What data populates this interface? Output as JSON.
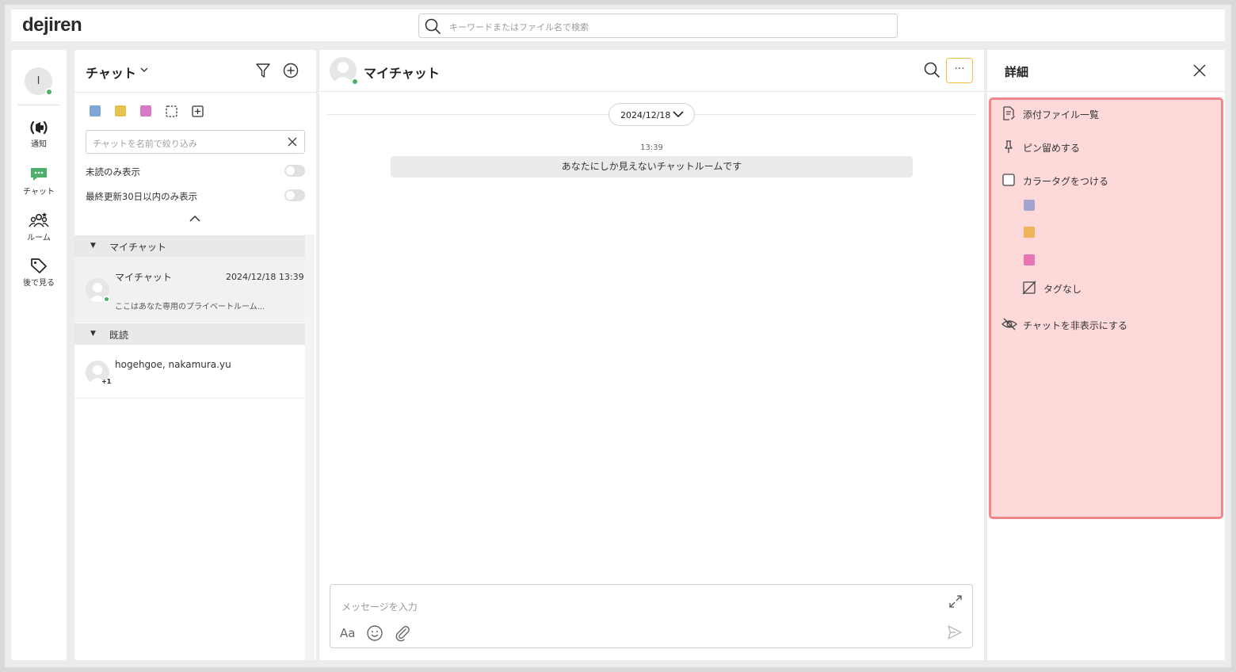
{
  "app": {
    "logo": "dejiren"
  },
  "search": {
    "placeholder": "キーワードまたはファイル名で検索"
  },
  "rail": {
    "avatar_initial": "I",
    "items": [
      {
        "label": "通知",
        "icon": "broadcast-icon"
      },
      {
        "label": "チャット",
        "icon": "chat-icon"
      },
      {
        "label": "ルーム",
        "icon": "people-icon"
      },
      {
        "label": "後で見る",
        "icon": "tag-icon"
      }
    ]
  },
  "chatlist": {
    "title": "チャット",
    "color_tags": [
      "#7ea7d8",
      "#e6c24f",
      "#d97ac8"
    ],
    "filter_placeholder": "チャットを名前で絞り込み",
    "toggles": [
      {
        "label": "未読のみ表示",
        "on": false
      },
      {
        "label": "最終更新30日以内のみ表示",
        "on": false
      }
    ],
    "groups": [
      {
        "label": "マイチャット",
        "items": [
          {
            "name": "マイチャット",
            "time": "2024/12/18 13:39",
            "preview": "ここはあなた専用のプライベートルーム..."
          }
        ]
      },
      {
        "label": "既読",
        "items": [
          {
            "name": "hogehgoe, nakamura.yu",
            "badge": "+1"
          }
        ]
      }
    ]
  },
  "main": {
    "title": "マイチャット",
    "more_label": "···",
    "date": "2024/12/18",
    "messages": [
      {
        "time": "13:39",
        "text": "あなたにしか見えないチャットルームです"
      }
    ],
    "composer": {
      "placeholder": "メッセージを入力",
      "format_label": "Aa"
    }
  },
  "detail": {
    "title": "詳細",
    "items": [
      {
        "label": "添付ファイル一覧",
        "icon": "file-list-icon"
      },
      {
        "label": "ピン留めする",
        "icon": "pin-icon"
      },
      {
        "label": "カラータグをつける",
        "icon": "checkbox-icon"
      }
    ],
    "color_options": [
      "#a4a4cf",
      "#efb35a",
      "#e774b3"
    ],
    "no_tag_label": "タグなし",
    "hide_label": "チャットを非表示にする",
    "highlight_color": "#f0868a"
  }
}
